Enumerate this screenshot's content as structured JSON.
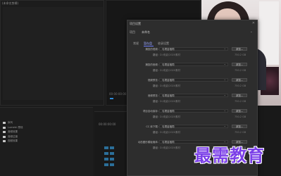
{
  "source_monitor": {
    "tab_label": "(未命名剪辑)"
  },
  "program_monitor": {
    "timecode": "00:00:00:00"
  },
  "project": {
    "items": [
      {
        "label": "序列"
      },
      {
        "label": "Lumetri 预设"
      },
      {
        "label": "音频效果"
      },
      {
        "label": "音频过渡"
      },
      {
        "label": "视频效果"
      }
    ]
  },
  "timeline": {
    "timecode": "00:00:00:00"
  },
  "dialog": {
    "title": "项目设置",
    "close": "✕",
    "header_label": "项目",
    "header_value": "未命名",
    "side_label": "常规",
    "tabs": [
      "暂存盘",
      "收录设置"
    ],
    "fields": [
      {
        "label": "捕捉的视频:",
        "select": "与项目相同",
        "browse": "浏览...",
        "sub_label": "路径:",
        "path": "D:\\电影\\2020素材",
        "free": "750.2 GB"
      },
      {
        "label": "捕捉的音频:",
        "select": "与项目相同",
        "browse": "浏览...",
        "sub_label": "路径:",
        "path": "D:\\电影\\2020素材",
        "free": "750.2 GB"
      },
      {
        "label": "视频预览:",
        "select": "与项目相同",
        "browse": "浏览...",
        "sub_label": "路径:",
        "path": "D:\\电影\\2020素材",
        "free": "750.2 GB"
      },
      {
        "label": "音频预览:",
        "select": "与项目相同",
        "browse": "浏览...",
        "sub_label": "路径:",
        "path": "D:\\电影\\2020素材",
        "free": "750.2 GB"
      },
      {
        "label": "项目自动保存:",
        "select": "与项目相同",
        "browse": "浏览...",
        "sub_label": "路径:",
        "path": "D:\\电影\\2020素材",
        "free": "750.2 GB"
      },
      {
        "label": "CC 库下载:",
        "select": "与项目相同",
        "browse": "浏览...",
        "sub_label": "路径:",
        "path": "D:\\电影\\2020素材",
        "free": "750.2 GB"
      },
      {
        "label": "动态图形模板媒体:",
        "select": "与项目相同",
        "browse": "浏览...",
        "sub_label": "路径:",
        "path": "D:\\电影\\2020素材",
        "free": "750.2 GB"
      }
    ]
  },
  "watermark": {
    "text": "最需教育"
  },
  "colors": {
    "accent": "#7b3fe8",
    "tab_active": "#9aa8ff",
    "track_button": "#2b6f9a"
  }
}
